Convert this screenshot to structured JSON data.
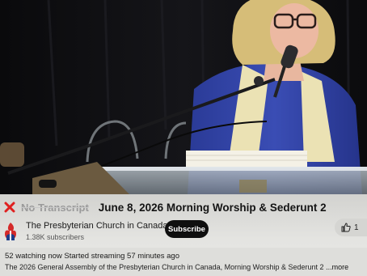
{
  "video": {
    "description": ""
  },
  "title_row": {
    "no_transcript_label": "No Transcript",
    "title": "June 8, 2026 Morning Worship & Sederunt 2"
  },
  "channel": {
    "name": "The Presbyterian Church in Canada",
    "subscribers": "1.38K subscribers",
    "subscribe_label": "Subscribe",
    "like_count": "1"
  },
  "description": {
    "watching": "52 watching now",
    "started": "Started streaming 57 minutes ago",
    "text": "The 2026 General Assembly of the Presbyterian Church in Canada, Morning Worship & Sederunt 2",
    "more_label": "...more"
  },
  "colors": {
    "close_icon": "#e02020",
    "subscribe_bg": "#0f0f0f",
    "robe": "#3346a8",
    "stole": "#ece3b6",
    "hair": "#d9c07a"
  },
  "icons": {
    "close": "close-icon",
    "channel_logo": "presbyterian-burning-bush-logo",
    "like": "thumbs-up-icon"
  }
}
